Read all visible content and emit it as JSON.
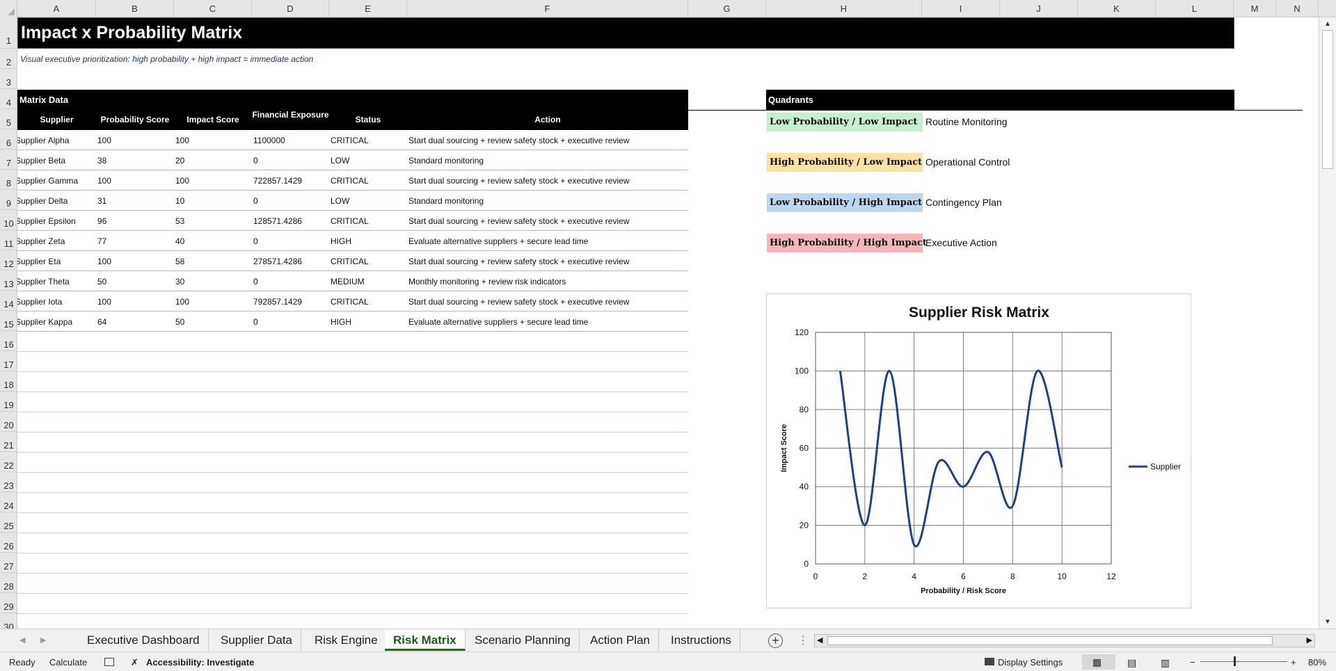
{
  "columns": [
    "A",
    "B",
    "C",
    "D",
    "E",
    "F",
    "G",
    "H",
    "I",
    "J",
    "K",
    "L",
    "M",
    "N"
  ],
  "rows": [
    "1",
    "2",
    "3",
    "4",
    "5",
    "6",
    "7",
    "8",
    "9",
    "10",
    "11",
    "12",
    "13",
    "14",
    "15",
    "16",
    "17",
    "18",
    "19",
    "20",
    "21",
    "22",
    "23",
    "24",
    "25",
    "26",
    "27",
    "28",
    "29",
    "30"
  ],
  "title": "Impact x Probability Matrix",
  "subtitle": "Visual executive prioritization: high probability + high impact = immediate action",
  "matrix": {
    "section_title": "Matrix Data",
    "headers": [
      "Supplier",
      "Probability Score",
      "Impact Score",
      "Financial Exposure",
      "Status",
      "Action"
    ],
    "rows": [
      [
        "Supplier Alpha",
        "100",
        "100",
        "1100000",
        "CRITICAL",
        "Start dual sourcing + review safety stock + executive review"
      ],
      [
        "Supplier Beta",
        "38",
        "20",
        "0",
        "LOW",
        "Standard monitoring"
      ],
      [
        "Supplier Gamma",
        "100",
        "100",
        "722857.1429",
        "CRITICAL",
        "Start dual sourcing + review safety stock + executive review"
      ],
      [
        "Supplier Delta",
        "31",
        "10",
        "0",
        "LOW",
        "Standard monitoring"
      ],
      [
        "Supplier Epsilon",
        "96",
        "53",
        "128571.4286",
        "CRITICAL",
        "Start dual sourcing + review safety stock + executive review"
      ],
      [
        "Supplier Zeta",
        "77",
        "40",
        "0",
        "HIGH",
        "Evaluate alternative suppliers + secure lead time"
      ],
      [
        "Supplier Eta",
        "100",
        "58",
        "278571.4286",
        "CRITICAL",
        "Start dual sourcing + review safety stock + executive review"
      ],
      [
        "Supplier Theta",
        "50",
        "30",
        "0",
        "MEDIUM",
        "Monthly monitoring + review risk indicators"
      ],
      [
        "Supplier Iota",
        "100",
        "100",
        "792857.1429",
        "CRITICAL",
        "Start dual sourcing + review safety stock + executive review"
      ],
      [
        "Supplier Kappa",
        "64",
        "50",
        "0",
        "HIGH",
        "Evaluate alternative suppliers + secure lead time"
      ]
    ]
  },
  "quadrants": {
    "section_title": "Quadrants",
    "items": [
      {
        "label": "Low Probability / Low Impact",
        "text": "Routine Monitoring",
        "color": "#c6efce"
      },
      {
        "label": "High Probability / Low Impact",
        "text": "Operational Control",
        "color": "#ffe0a6"
      },
      {
        "label": "Low Probability / High Impact",
        "text": "Contingency Plan",
        "color": "#bdd7ee"
      },
      {
        "label": "High Probability / High Impact",
        "text": "Executive Action",
        "color": "#f4b6b6"
      }
    ]
  },
  "chart_data": {
    "type": "line",
    "title": "Supplier Risk Matrix",
    "xlabel": "Probability / Risk Score",
    "ylabel": "Impact Score",
    "xlim": [
      0,
      12
    ],
    "ylim": [
      0,
      120
    ],
    "xticks": [
      0,
      2,
      4,
      6,
      8,
      10,
      12
    ],
    "yticks": [
      0,
      20,
      40,
      60,
      80,
      100,
      120
    ],
    "grid": true,
    "smooth": true,
    "legend": "right",
    "x": [
      1,
      2,
      3,
      4,
      5,
      6,
      7,
      8,
      9,
      10
    ],
    "series": [
      {
        "name": "Supplier",
        "color": "#1f3f84",
        "values": [
          100,
          20,
          100,
          10,
          53,
          40,
          58,
          30,
          100,
          50
        ]
      }
    ]
  },
  "tabs": [
    "Executive Dashboard",
    "Supplier Data",
    "Risk Engine",
    "Risk Matrix",
    "Scenario Planning",
    "Action Plan",
    "Instructions"
  ],
  "active_tab": "Risk Matrix",
  "status": {
    "ready": "Ready",
    "calculate": "Calculate",
    "accessibility": "Accessibility: Investigate",
    "display_settings": "Display Settings",
    "zoom": "80%"
  },
  "icons": {
    "nav_prev": "triangle-left-icon",
    "nav_next": "triangle-right-icon",
    "add_sheet": "plus-circle-icon",
    "view_normal": "grid-icon",
    "view_page_layout": "page-layout-icon",
    "view_page_break": "page-break-icon"
  }
}
